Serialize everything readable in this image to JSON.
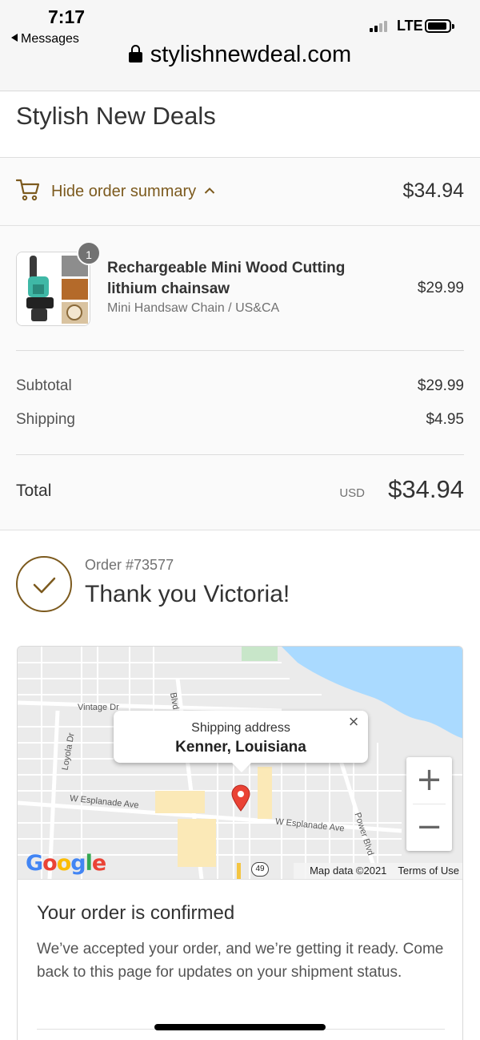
{
  "status_bar": {
    "time": "7:17",
    "back_app": "Messages",
    "network": "LTE"
  },
  "browser": {
    "url": "stylishnewdeal.com",
    "lock_icon": "lock-icon"
  },
  "shop": {
    "name": "Stylish New Deals"
  },
  "summary_toggle": {
    "label": "Hide order summary",
    "total": "$34.94",
    "icon": "cart-icon",
    "accent_color": "#7c5a1e"
  },
  "order_summary": {
    "items": [
      {
        "quantity": "1",
        "name": "Rechargeable Mini Wood Cutting lithium chainsaw",
        "variant": "Mini Handsaw Chain / US&CA",
        "price": "$29.99"
      }
    ],
    "subtotal_label": "Subtotal",
    "subtotal_value": "$29.99",
    "shipping_label": "Shipping",
    "shipping_value": "$4.95",
    "total_label": "Total",
    "total_currency": "USD",
    "total_value": "$34.94"
  },
  "confirmation": {
    "order_number": "Order #73577",
    "thank_you": "Thank you Victoria!"
  },
  "map": {
    "popup_title": "Shipping address",
    "popup_city": "Kenner, Louisiana",
    "zoom_in": "+",
    "zoom_out": "−",
    "attribution": "Map data ©2021",
    "terms": "Terms of Use",
    "street_labels": {
      "vintage": "Vintage Dr",
      "loyola": "Loyola Dr",
      "esplanade_west": "W Esplanade Ave",
      "esplanade_east": "W Esplanade Ave",
      "power": "Power Blvd",
      "blvd": "Blvd",
      "route": "49"
    }
  },
  "order_status": {
    "title": "Your order is confirmed",
    "text": "We’ve accepted your order, and we’re getting it ready. Come back to this page for updates on your shipment status."
  }
}
